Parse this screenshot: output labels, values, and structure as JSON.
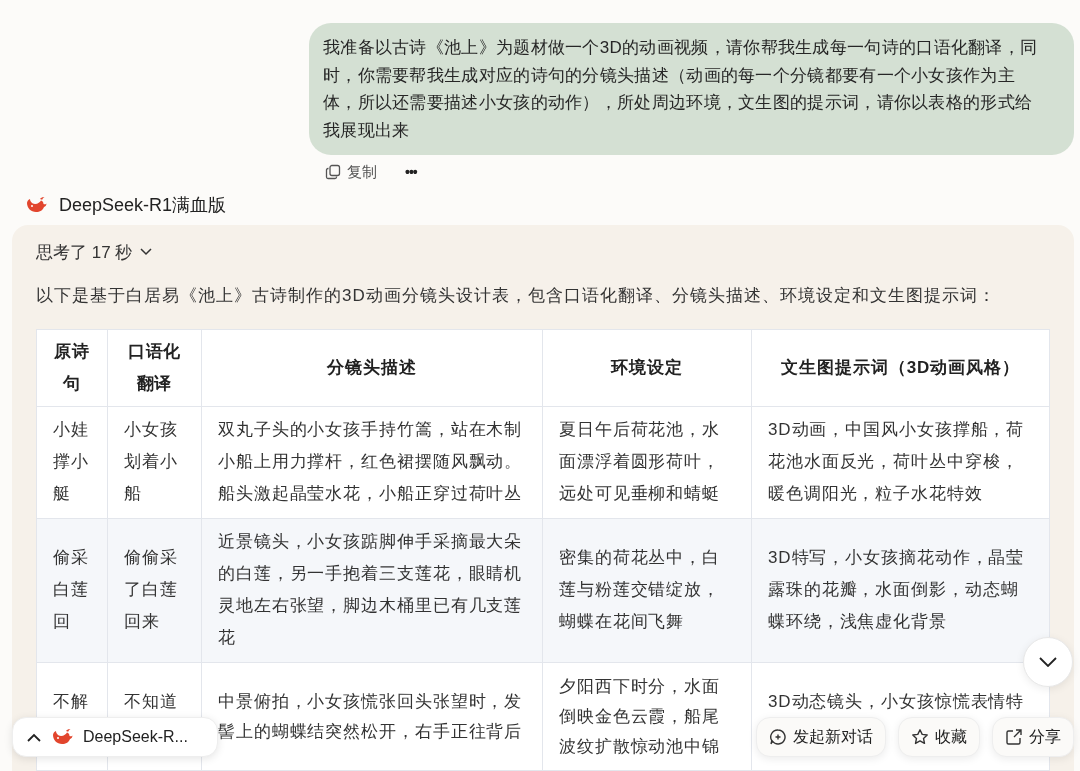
{
  "user_message": {
    "text": "我准备以古诗《池上》为题材做一个3D的动画视频，请你帮我生成每一句诗的口语化翻译，同时，你需要帮我生成对应的诗句的分镜头描述（动画的每一个分镜都要有一个小女孩作为主体，所以还需要描述小女孩的动作），所处周边环境，文生图的提示词，请你以表格的形式给我展现出来",
    "actions": [
      {
        "kind": "copy",
        "label": "复制"
      },
      {
        "kind": "more",
        "label": "•••"
      }
    ]
  },
  "assistant": {
    "name": "DeepSeek-R1满血版",
    "thinking": {
      "label": "思考了 17 秒",
      "expanded": false
    },
    "intro": "以下是基于白居易《池上》古诗制作的3D动画分镜头设计表，包含口语化翻译、分镜头描述、环境设定和文生图提示词：",
    "table": {
      "columns": [
        "原诗句",
        "口语化翻译",
        "分镜头描述",
        "环境设定",
        "文生图提示词（3D动画风格）"
      ],
      "rows": [
        {
          "cells": [
            "小娃撑小艇",
            "小女孩划着小船",
            "双丸子头的小女孩手持竹篙，站在木制小船上用力撑杆，红色裙摆随风飘动。船头激起晶莹水花，小船正穿过荷叶丛",
            "夏日午后荷花池，水面漂浮着圆形荷叶，远处可见垂柳和蜻蜓",
            "3D动画，中国风小女孩撑船，荷花池水面反光，荷叶丛中穿梭，暖色调阳光，粒子水花特效"
          ]
        },
        {
          "cells": [
            "偷采白莲回",
            "偷偷采了白莲回来",
            "近景镜头，小女孩踮脚伸手采摘最大朵的白莲，另一手抱着三支莲花，眼睛机灵地左右张望，脚边木桶里已有几支莲花",
            "密集的荷花丛中，白莲与粉莲交错绽放，蝴蝶在花间飞舞",
            "3D特写，小女孩摘花动作，晶莹露珠的花瓣，水面倒影，动态蝴蝶环绕，浅焦虚化背景"
          ]
        },
        {
          "cells": [
            "不解",
            "不知道",
            "中景俯拍，小女孩慌张回头张望时，发髻上的蝴蝶结突然松开，右手正往背后",
            "夕阳西下时分，水面倒映金色云霞，船尾波纹扩散惊动池中锦",
            "3D动态镜头，小女孩惊慌表情特"
          ]
        }
      ]
    }
  },
  "floating_bar": {
    "model_pill": "DeepSeek-R...",
    "buttons": [
      {
        "kind": "new-chat",
        "label": "发起新对话"
      },
      {
        "kind": "favorite",
        "label": "收藏"
      },
      {
        "kind": "share",
        "label": "分享"
      }
    ]
  }
}
